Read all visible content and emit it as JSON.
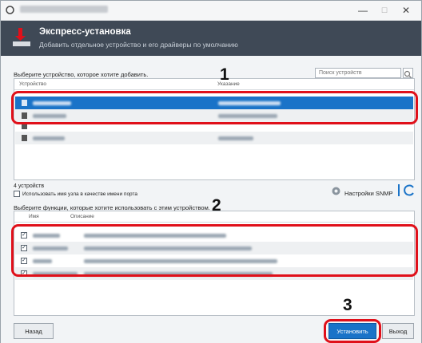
{
  "window": {
    "minimize_glyph": "—",
    "maximize_glyph": "☐",
    "close_glyph": "✕"
  },
  "header": {
    "title": "Экспресс-установка",
    "subtitle": "Добавить отдельное устройство и его драйверы по умолчанию"
  },
  "devices": {
    "label": "Выберите устройство, которое хотите добавить.",
    "search_placeholder": "Поиск устройств",
    "columns": [
      "Устройство",
      "Указание"
    ],
    "count_text": "4 устройств"
  },
  "options": {
    "use_host_name_label": "Использовать имя узла в качестве имени порта",
    "snmp_label": "Настройки SNMP"
  },
  "functions": {
    "label": "Выберите функции, которые хотите использовать с этим устройством.",
    "columns": [
      "Имя",
      "Описание"
    ]
  },
  "annotations": [
    "1",
    "2",
    "3"
  ],
  "buttons": {
    "back": "Назад",
    "install": "Установить",
    "exit": "Выход"
  },
  "colors": {
    "accent": "#1a73c8",
    "header_bg": "#3f4956",
    "callout": "#e0101a"
  }
}
